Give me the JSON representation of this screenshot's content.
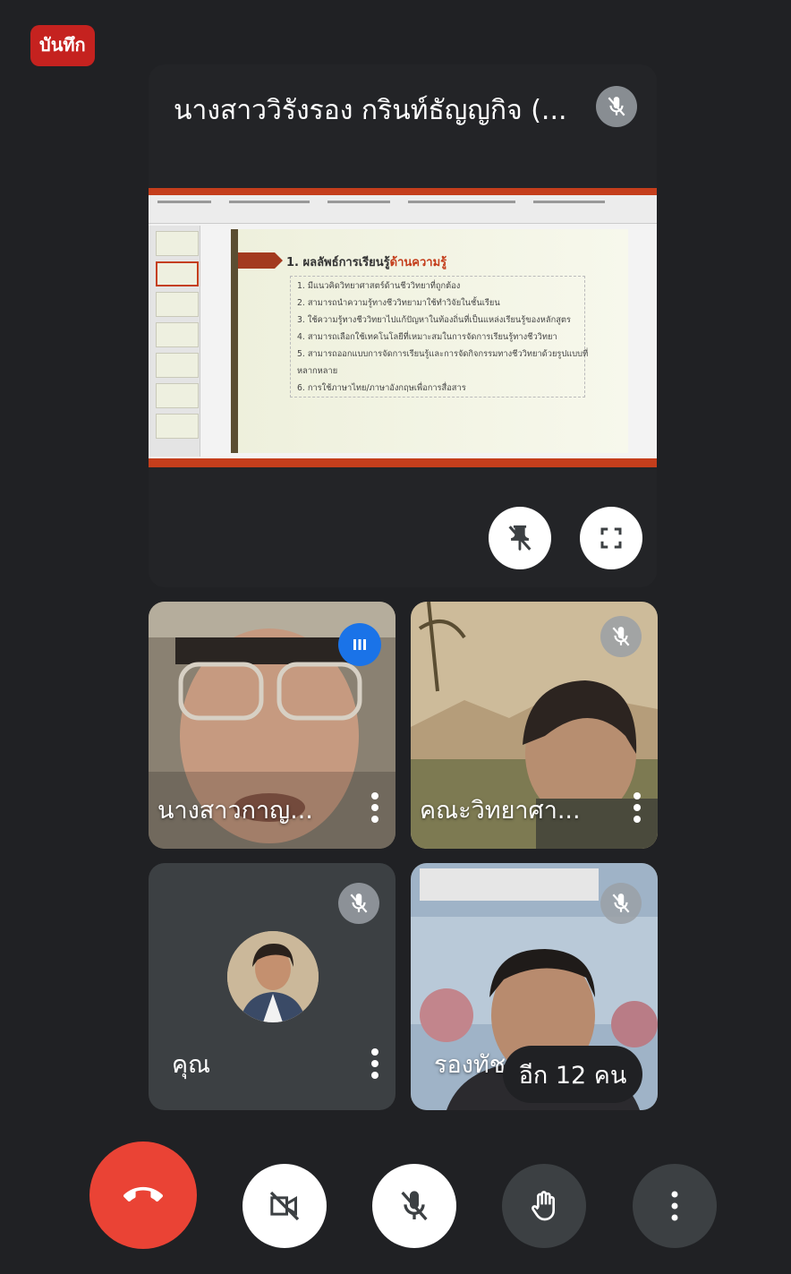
{
  "recording": {
    "label": "บันทึก"
  },
  "presenter": {
    "name": "นางสาววิรังรอง กรินท์ธัญญกิจ (...",
    "slide": {
      "heading_prefix": "1. ผลลัพธ์การเรียนรู้",
      "heading_highlight": "ด้านความรู้",
      "items": [
        "1. มีแนวคิดวิทยาศาสตร์ด้านชีววิทยาที่ถูกต้อง",
        "2. สามารถนำความรู้ทางชีววิทยามาใช้ทำวิจัยในชั้นเรียน",
        "3. ใช้ความรู้ทางชีววิทยาไปแก้ปัญหาในท้องถิ่นที่เป็นแหล่งเรียนรู้ของหลักสูตร",
        "4. สามารถเลือกใช้เทคโนโลยีที่เหมาะสมในการจัดการเรียนรู้ทางชีววิทยา",
        "5. สามารถออกแบบการจัดการเรียนรู้และการจัดกิจกรรมทางชีววิทยาด้วยรูปแบบที่",
        "หลากหลาย",
        "6. การใช้ภาษาไทย/ภาษาอังกฤษเพื่อการสื่อสาร"
      ]
    }
  },
  "participants": [
    {
      "name": "นางสาวกาญ..."
    },
    {
      "name": "คณะวิทยาศา..."
    },
    {
      "name": "คุณ"
    },
    {
      "name": "รองทัช"
    }
  ],
  "more_people": {
    "label": "อีก 12 คน"
  },
  "icons": {
    "mic_off": "mic-off-icon",
    "pin_off": "pin-off-icon",
    "fullscreen": "fullscreen-icon",
    "end_call": "phone-hangup-icon",
    "camera_off": "videocam-off-icon",
    "raise_hand": "hand-icon",
    "more": "more-vert-icon",
    "speaking": "audio-level-icon"
  },
  "colors": {
    "background": "#202124",
    "end_call": "#ea4335",
    "speaking": "#1a73e8",
    "recording": "#c5221f"
  }
}
